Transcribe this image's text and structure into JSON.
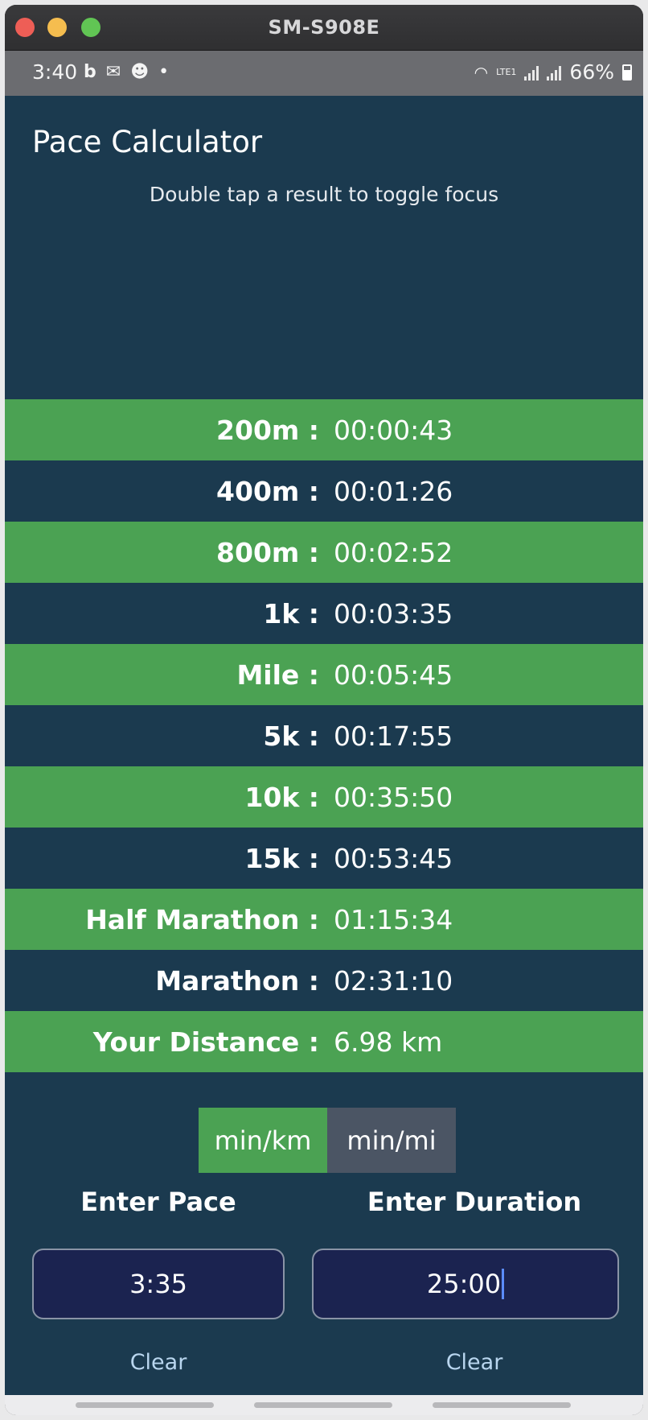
{
  "window": {
    "title": "SM-S908E"
  },
  "status_bar": {
    "time": "3:40",
    "battery": "66%",
    "network": "LTE1"
  },
  "app": {
    "title": "Pace Calculator",
    "hint": "Double tap a result to toggle focus"
  },
  "results": [
    {
      "label": "200m :",
      "value": "00:00:43"
    },
    {
      "label": "400m :",
      "value": "00:01:26"
    },
    {
      "label": "800m :",
      "value": "00:02:52"
    },
    {
      "label": "1k :",
      "value": "00:03:35"
    },
    {
      "label": "Mile :",
      "value": "00:05:45"
    },
    {
      "label": "5k :",
      "value": "00:17:55"
    },
    {
      "label": "10k :",
      "value": "00:35:50"
    },
    {
      "label": "15k :",
      "value": "00:53:45"
    },
    {
      "label": "Half Marathon :",
      "value": "01:15:34"
    },
    {
      "label": "Marathon :",
      "value": "02:31:10"
    },
    {
      "label": "Your Distance :",
      "value": "6.98 km"
    }
  ],
  "units": {
    "km": "min/km",
    "mi": "min/mi",
    "selected": "min/km"
  },
  "pace": {
    "label": "Enter Pace",
    "value": "3:35",
    "clear": "Clear"
  },
  "duration": {
    "label": "Enter Duration",
    "value": "25:00",
    "clear": "Clear"
  },
  "colors": {
    "background": "#1b3a4f",
    "accent": "#4ba253",
    "inactive": "#4b5564",
    "input": "#1b2350"
  }
}
